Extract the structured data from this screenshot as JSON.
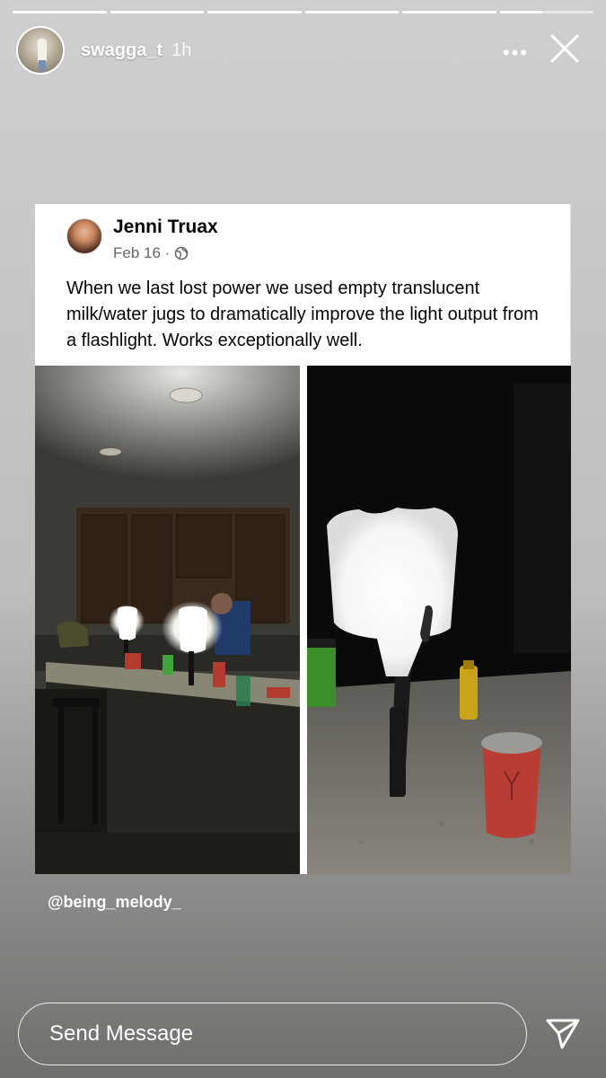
{
  "story": {
    "segments": [
      {
        "progress": 1
      },
      {
        "progress": 1
      },
      {
        "progress": 1
      },
      {
        "progress": 1
      },
      {
        "progress": 1
      },
      {
        "progress": 0.45
      }
    ],
    "username": "swagga_t",
    "time": "1h",
    "more_icon": "more-horizontal-icon",
    "close_icon": "close-icon"
  },
  "post": {
    "author": "Jenni Truax",
    "date": "Feb 16 ·",
    "privacy_icon": "globe-icon",
    "text": "When we last lost power we used empty translucent milk/water jugs to dramatically improve the light output from a flashlight.  Works exceptionally well."
  },
  "mention": "@being_melody_",
  "message": {
    "placeholder": "Send Message",
    "send_icon": "paper-plane-icon"
  }
}
